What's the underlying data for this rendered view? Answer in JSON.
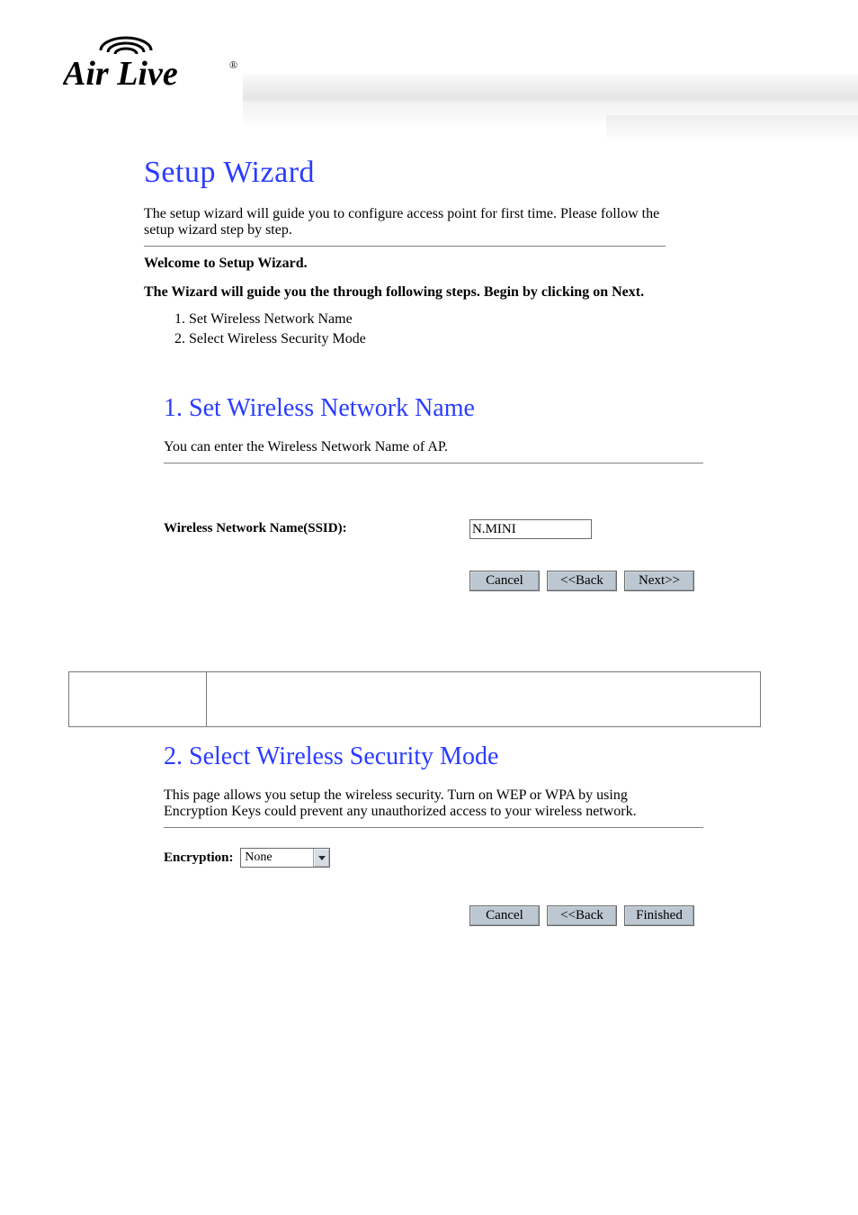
{
  "brand": "Air Live",
  "wizard": {
    "title": "Setup Wizard",
    "intro": "The setup wizard will guide you to configure access point for first time. Please follow the setup wizard step by step.",
    "welcome": "Welcome to Setup Wizard.",
    "guide": "The Wizard will guide you the through following steps. Begin by clicking on Next.",
    "steps": [
      "Set Wireless Network Name",
      "Select Wireless Security Mode"
    ]
  },
  "step1": {
    "heading": "1. Set Wireless Network Name",
    "desc": "You can enter the Wireless Network Name of AP.",
    "ssid_label": "Wireless Network Name(SSID):",
    "ssid_value": "N.MINI",
    "buttons": {
      "cancel": "Cancel",
      "back": "<<Back",
      "next": "Next>>"
    }
  },
  "step2": {
    "heading": "2. Select Wireless Security Mode",
    "desc": "This page allows you setup the wireless security. Turn on WEP or WPA by using Encryption Keys could prevent any unauthorized access to your wireless network.",
    "enc_label": "Encryption:",
    "enc_value": "None",
    "buttons": {
      "cancel": "Cancel",
      "back": "<<Back",
      "finished": "Finished"
    }
  }
}
